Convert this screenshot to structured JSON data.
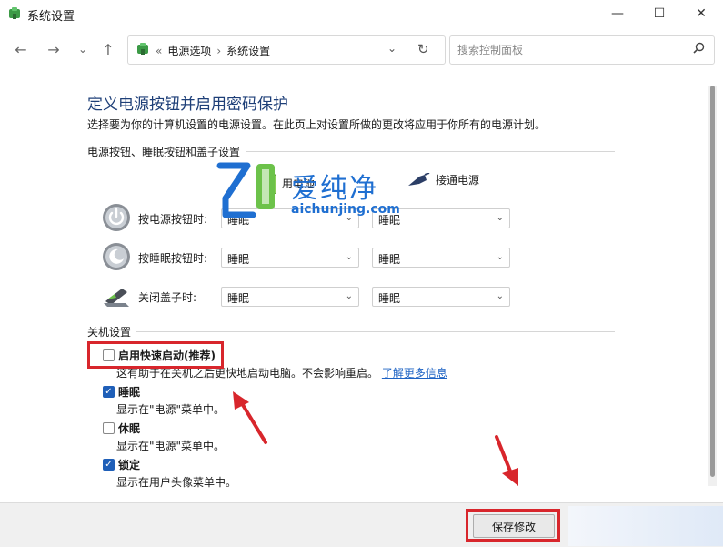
{
  "window": {
    "title": "系统设置",
    "min_glyph": "—",
    "max_glyph": "☐",
    "close_glyph": "✕"
  },
  "nav": {
    "back_glyph": "←",
    "forward_glyph": "→",
    "recent_glyph": "⌄",
    "up_glyph": "↑"
  },
  "address": {
    "prefix": "«",
    "crumb1": "电源选项",
    "sep": "›",
    "crumb2": "系统设置",
    "dropdown_glyph": "⌄",
    "refresh_glyph": "↻"
  },
  "search": {
    "placeholder": "搜索控制面板",
    "icon_glyph": "⚲"
  },
  "page": {
    "heading": "定义电源按钮并启用密码保护",
    "description": "选择要为你的计算机设置的电源设置。在此页上对设置所做的更改将应用于你所有的电源计划。"
  },
  "power_section": {
    "label": "电源按钮、睡眠按钮和盖子设置",
    "col_battery": "用电池",
    "col_plugged": "接通电源",
    "rows": [
      {
        "label": "按电源按钮时:",
        "battery": "睡眠",
        "plugged": "睡眠"
      },
      {
        "label": "按睡眠按钮时:",
        "battery": "睡眠",
        "plugged": "睡眠"
      },
      {
        "label": "关闭盖子时:",
        "battery": "睡眠",
        "plugged": "睡眠"
      }
    ],
    "arrow_glyph": "⌄"
  },
  "shutdown_section": {
    "label": "关机设置",
    "items": [
      {
        "label": "启用快速启动(推荐)",
        "checked": false,
        "desc": "这有助于在关机之后更快地启动电脑。不会影响重启。",
        "link": "了解更多信息"
      },
      {
        "label": "睡眠",
        "checked": true,
        "desc": "显示在\"电源\"菜单中。"
      },
      {
        "label": "休眠",
        "checked": false,
        "desc": "显示在\"电源\"菜单中。"
      },
      {
        "label": "锁定",
        "checked": true,
        "desc": "显示在用户头像菜单中。"
      }
    ],
    "check_glyph": "✓"
  },
  "footer": {
    "save_label": "保存修改"
  },
  "watermark": {
    "brand": "爱纯净",
    "url": "aichunjing.com"
  },
  "colors": {
    "heading": "#1e3f78",
    "highlight": "#d8262c",
    "link": "#1e63c4",
    "checkbox": "#1f5fb8"
  }
}
